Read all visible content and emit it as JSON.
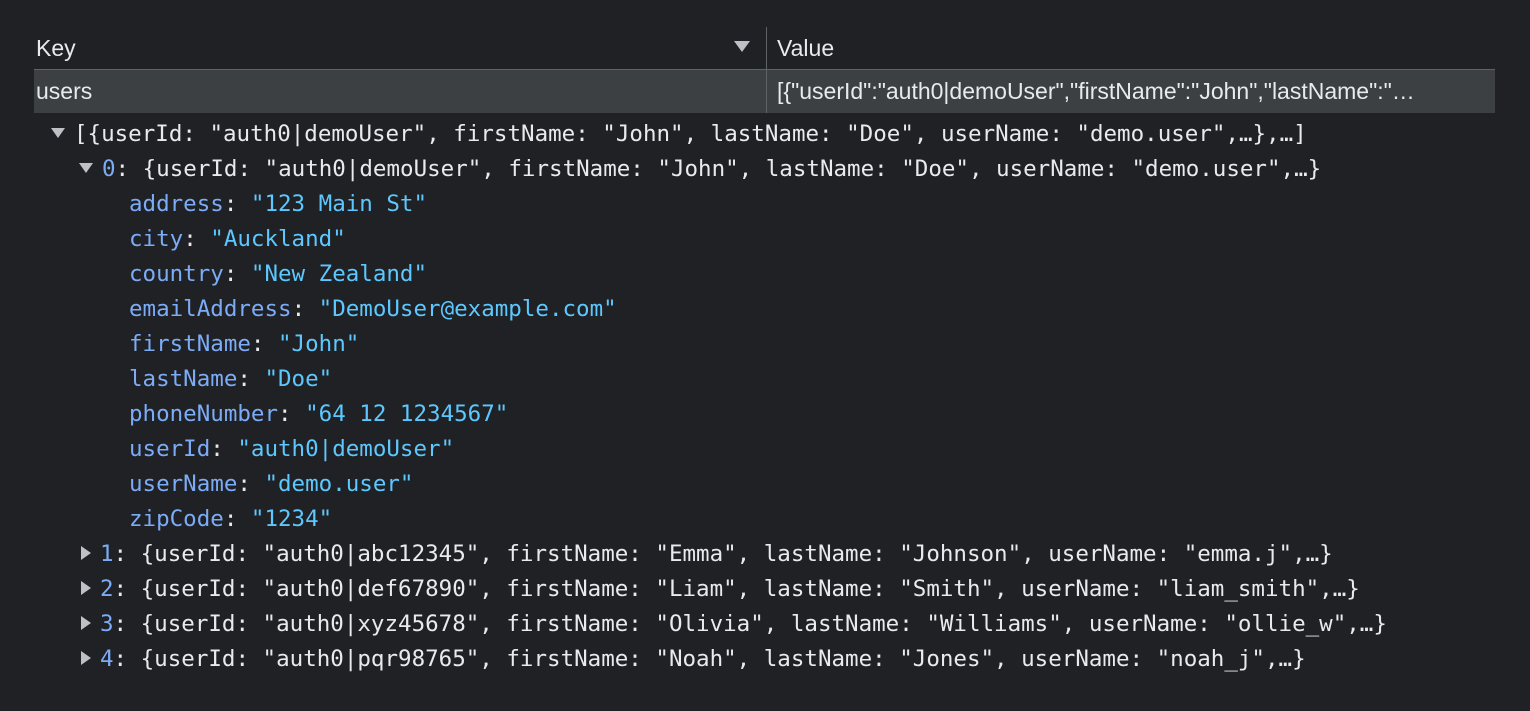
{
  "table": {
    "key_header": "Key",
    "value_header": "Value",
    "row": {
      "key": "users",
      "value": "[{\"userId\":\"auth0|demoUser\",\"firstName\":\"John\",\"lastName\":\"...",
      "value_display": "[{\"userId\":\"auth0|demoUser\",\"firstName\":\"John\",\"lastName\":\"…"
    }
  },
  "tree": {
    "root_summary": "[{userId: \"auth0|demoUser\", firstName: \"John\", lastName: \"Doe\", userName: \"demo.user\",…},…]",
    "item0": {
      "index": "0",
      "summary": "{userId: \"auth0|demoUser\", firstName: \"John\", lastName: \"Doe\", userName: \"demo.user\",…}",
      "props": [
        {
          "key": "address",
          "value": "\"123 Main St\""
        },
        {
          "key": "city",
          "value": "\"Auckland\""
        },
        {
          "key": "country",
          "value": "\"New Zealand\""
        },
        {
          "key": "emailAddress",
          "value": "\"DemoUser@example.com\""
        },
        {
          "key": "firstName",
          "value": "\"John\""
        },
        {
          "key": "lastName",
          "value": "\"Doe\""
        },
        {
          "key": "phoneNumber",
          "value": "\"64 12 1234567\""
        },
        {
          "key": "userId",
          "value": "\"auth0|demoUser\""
        },
        {
          "key": "userName",
          "value": "\"demo.user\""
        },
        {
          "key": "zipCode",
          "value": "\"1234\""
        }
      ]
    },
    "collapsed_items": [
      {
        "index": "1",
        "summary": "{userId: \"auth0|abc12345\", firstName: \"Emma\", lastName: \"Johnson\", userName: \"emma.j\",…}"
      },
      {
        "index": "2",
        "summary": "{userId: \"auth0|def67890\", firstName: \"Liam\", lastName: \"Smith\", userName: \"liam_smith\",…}"
      },
      {
        "index": "3",
        "summary": "{userId: \"auth0|xyz45678\", firstName: \"Olivia\", lastName: \"Williams\", userName: \"ollie_w\",…}"
      },
      {
        "index": "4",
        "summary": "{userId: \"auth0|pqr98765\", firstName: \"Noah\", lastName: \"Jones\", userName: \"noah_j\",…}"
      }
    ]
  },
  "colors": {
    "background": "#202124",
    "selected_row": "#3c4043",
    "property_key": "#7cacf8",
    "string_value": "#5cc8ff"
  }
}
